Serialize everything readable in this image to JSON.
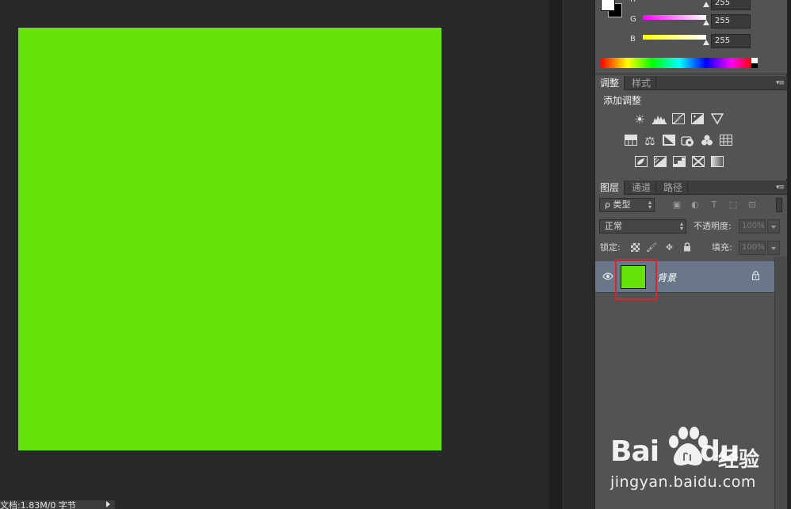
{
  "colors": {
    "canvas_fill": "#67e30c",
    "layer_selected": "#6a7789",
    "highlight_box": "#d7262e"
  },
  "color_panel": {
    "channels": [
      {
        "label": "R",
        "value": "255",
        "gradient": "linear-gradient(to right,#000,#ff0000)"
      },
      {
        "label": "G",
        "value": "255",
        "gradient": "linear-gradient(to right,#ff00ff,#ffffff)"
      },
      {
        "label": "B",
        "value": "255",
        "gradient": "linear-gradient(to right,#ffff00,#ffffff)"
      }
    ]
  },
  "adjustments": {
    "tabs": [
      {
        "label": "调整"
      },
      {
        "label": "样式"
      }
    ],
    "title": "添加调整",
    "icons": [
      [
        "brightness-contrast-icon",
        "levels-icon",
        "curves-icon",
        "exposure-icon",
        "vibrance-icon"
      ],
      [
        "hue-saturation-icon",
        "color-balance-icon",
        "black-white-icon",
        "photo-filter-icon",
        "channel-mixer-icon",
        "color-lookup-icon"
      ],
      [
        "invert-icon",
        "posterize-icon",
        "threshold-icon",
        "selective-color-icon",
        "gradient-map-icon"
      ]
    ]
  },
  "layers": {
    "tabs": [
      {
        "label": "图层"
      },
      {
        "label": "通道"
      },
      {
        "label": "路径"
      }
    ],
    "filter": {
      "label": "ρ 类型"
    },
    "filter_icons": [
      "image-filter-icon",
      "adjustment-filter-icon",
      "type-filter-icon",
      "shape-filter-icon",
      "smart-object-filter-icon"
    ],
    "blend_mode": "正常",
    "opacity_label": "不透明度:",
    "opacity_value": "100%",
    "lock_label": "锁定:",
    "fill_label": "填充:",
    "fill_value": "100%",
    "lock_icons": [
      "lock-transparent-icon",
      "lock-paint-icon",
      "lock-position-icon",
      "lock-all-icon"
    ],
    "items": [
      {
        "name": "背景",
        "visible": true,
        "locked": true
      }
    ]
  },
  "status": {
    "doc_info": "文档:1.83M/0 字节"
  },
  "watermark": {
    "brand": "Bai",
    "brand_suffix": "du",
    "product": "经验",
    "url": "jingyan.baidu.com"
  }
}
